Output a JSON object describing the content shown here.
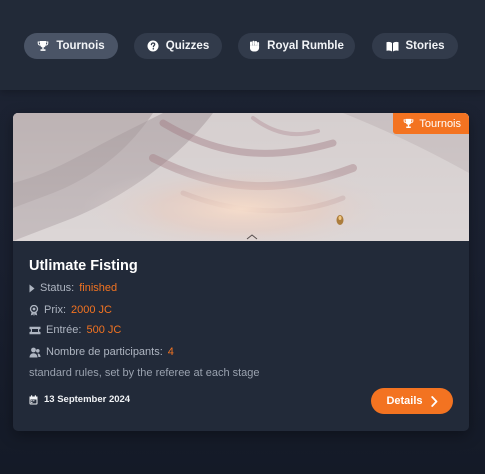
{
  "nav": {
    "tabs": [
      {
        "label": "Tournois",
        "icon": "trophy-icon",
        "active": true
      },
      {
        "label": "Quizzes",
        "icon": "question-circle-icon",
        "active": false
      },
      {
        "label": "Royal Rumble",
        "icon": "fist-icon",
        "active": false
      },
      {
        "label": "Stories",
        "icon": "book-icon",
        "active": false
      }
    ]
  },
  "card": {
    "badge": {
      "label": "Tournois",
      "icon": "trophy-icon"
    },
    "title": "Utlimate Fisting",
    "status": {
      "label": "Status:",
      "value": "finished"
    },
    "prize": {
      "label": "Prix:",
      "value": "2000 JC"
    },
    "entry": {
      "label": "Entrée:",
      "value": "500 JC"
    },
    "participants": {
      "label": "Nombre de participants:",
      "value": "4"
    },
    "description": "standard rules, set by the referee at each stage",
    "date": "13 September 2024",
    "details_label": "Details"
  },
  "colors": {
    "accent": "#f37321",
    "background": "#1b2130",
    "card": "#222a39",
    "pill": "#323b4b",
    "pill_active": "#4a5466"
  }
}
